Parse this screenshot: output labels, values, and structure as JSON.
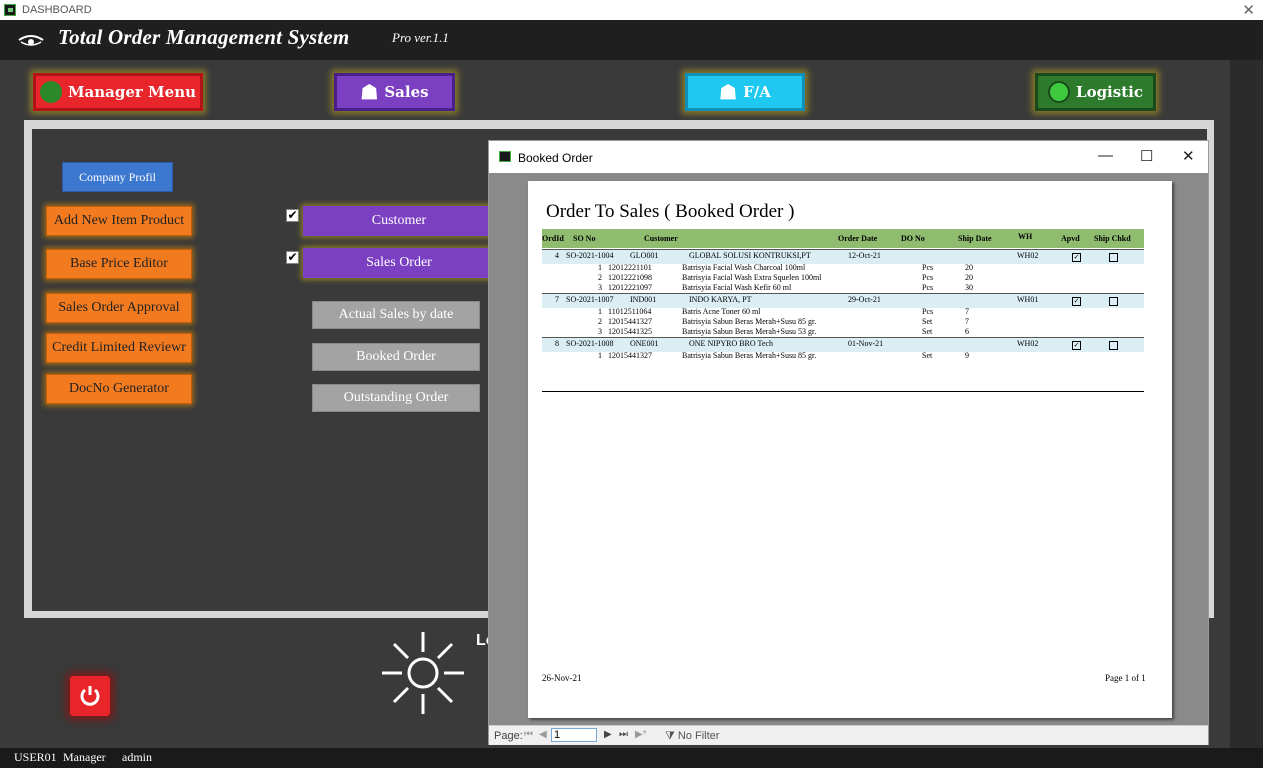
{
  "window": {
    "title": "DASHBOARD"
  },
  "header": {
    "app_title": "Total Order Management System",
    "version": "Pro ver.1.1"
  },
  "nav": {
    "manager": "Manager Menu",
    "sales": "Sales",
    "fa": "F/A",
    "logistic": "Logistic"
  },
  "left_buttons": {
    "company": "Company Profil",
    "add_item": "Add New Item Product",
    "base_price": "Base Price Editor",
    "so_approval": "Sales Order Approval",
    "credit": "Credit Limited Reviewr",
    "docno": "DocNo Generator"
  },
  "sales_panel": {
    "customer": "Customer",
    "sales_order": "Sales Order",
    "actual_sales": "Actual Sales by date",
    "booked_order": "Booked Order",
    "outstanding": "Outstanding Order",
    "check_mark": "✔"
  },
  "lo_text": "Lo",
  "status": {
    "user": "USER01",
    "role": "Manager",
    "name": "admin"
  },
  "dialog": {
    "title": "Booked Order",
    "report_title": "Order To Sales ( Booked Order )",
    "headers": {
      "ordid": "OrdId",
      "sono": "SO No",
      "customer": "Customer",
      "order_date": "Order Date",
      "do_no": "DO No",
      "ship_date": "Ship Date",
      "wh": "WH",
      "apvd": "Apvd",
      "ship_chkd": "Ship Chkd"
    },
    "groups": [
      {
        "ordid": "4",
        "sono": "SO-2021-1004",
        "code": "GLO001",
        "customer": "GLOBAL SOLUSI KONTRUKSI,PT",
        "order_date": "12-Oct-21",
        "wh": "WH02",
        "apvd": true,
        "ship_chkd": false,
        "lines": [
          {
            "no": "1",
            "item": "12012221101",
            "desc": "Batrisyia Facial Wash Charcoal 100ml",
            "unit": "Pcs",
            "qty": "20"
          },
          {
            "no": "2",
            "item": "12012221098",
            "desc": "Batrisyia Facial Wash Extra Squelen 100ml",
            "unit": "Pcs",
            "qty": "20"
          },
          {
            "no": "3",
            "item": "12012221097",
            "desc": "Batrisyia Facial Wash Kefir 60 ml",
            "unit": "Pcs",
            "qty": "30"
          }
        ]
      },
      {
        "ordid": "7",
        "sono": "SO-2021-1007",
        "code": "IND001",
        "customer": "INDO KARYA, PT",
        "order_date": "29-Oct-21",
        "wh": "WH01",
        "apvd": true,
        "ship_chkd": false,
        "lines": [
          {
            "no": "1",
            "item": "11012511064",
            "desc": "Batris Acne Toner 60 ml",
            "unit": "Pcs",
            "qty": "7"
          },
          {
            "no": "2",
            "item": "12015441327",
            "desc": "Batrisyia Sabun Beras Merah+Susu 85 gr.",
            "unit": "Set",
            "qty": "7"
          },
          {
            "no": "3",
            "item": "12015441325",
            "desc": "Batrisyia Sabun Beras Merah+Susu 53 gr.",
            "unit": "Set",
            "qty": "6"
          }
        ]
      },
      {
        "ordid": "8",
        "sono": "SO-2021-1008",
        "code": "ONE001",
        "customer": "ONE NIPYRO BRO Tech",
        "order_date": "01-Nov-21",
        "wh": "WH02",
        "apvd": true,
        "ship_chkd": false,
        "lines": [
          {
            "no": "1",
            "item": "12015441327",
            "desc": "Batrisyia Sabun Beras Merah+Susu 85 gr.",
            "unit": "Set",
            "qty": "9"
          }
        ]
      }
    ],
    "footer_date": "26-Nov-21",
    "footer_page": "Page 1 of 1",
    "nav": {
      "page_label": "Page:",
      "page_value": "1",
      "no_filter": "No Filter"
    }
  }
}
